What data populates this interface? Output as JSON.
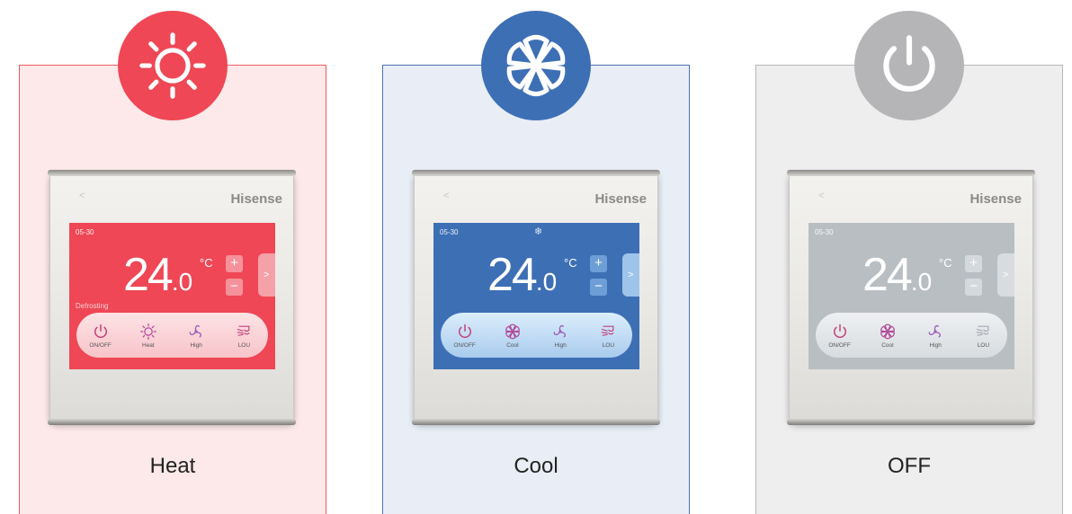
{
  "colors": {
    "heat": "#ef4755",
    "cool": "#3d6fb5",
    "off": "#b5b5b8"
  },
  "panels": [
    {
      "mode_label": "Heat",
      "badge_icon": "sun-icon",
      "device": {
        "brand": "Hisense",
        "date": "05-30",
        "temp": "24",
        "temp_decimal": ".0",
        "unit": "°C",
        "status": "Defrosting",
        "mode_indicator": "",
        "plus": "+",
        "minus": "−",
        "side_arrow": ">",
        "buttons": [
          {
            "icon": "power-icon",
            "label": "ON/OFF"
          },
          {
            "icon": "sun-icon",
            "label": "Heat"
          },
          {
            "icon": "fan-icon",
            "label": "High"
          },
          {
            "icon": "louver-icon",
            "label": "LOU"
          }
        ]
      }
    },
    {
      "mode_label": "Cool",
      "badge_icon": "snowflake-icon",
      "device": {
        "brand": "Hisense",
        "date": "05-30",
        "temp": "24",
        "temp_decimal": ".0",
        "unit": "°C",
        "status": "",
        "mode_indicator": "❄",
        "plus": "+",
        "minus": "−",
        "side_arrow": ">",
        "buttons": [
          {
            "icon": "power-icon",
            "label": "ON/OFF"
          },
          {
            "icon": "snowflake-icon",
            "label": "Cool"
          },
          {
            "icon": "fan-icon",
            "label": "High"
          },
          {
            "icon": "louver-icon",
            "label": "LOU"
          }
        ]
      }
    },
    {
      "mode_label": "OFF",
      "badge_icon": "power-icon",
      "device": {
        "brand": "Hisense",
        "date": "05-30",
        "temp": "24",
        "temp_decimal": ".0",
        "unit": "°C",
        "status": "",
        "mode_indicator": "",
        "plus": "+",
        "minus": "−",
        "side_arrow": ">",
        "buttons": [
          {
            "icon": "power-icon",
            "label": "ON/OFF"
          },
          {
            "icon": "snowflake-icon",
            "label": "Cool"
          },
          {
            "icon": "fan-icon",
            "label": "High"
          },
          {
            "icon": "louver-icon",
            "label": "LOU"
          }
        ]
      }
    }
  ]
}
